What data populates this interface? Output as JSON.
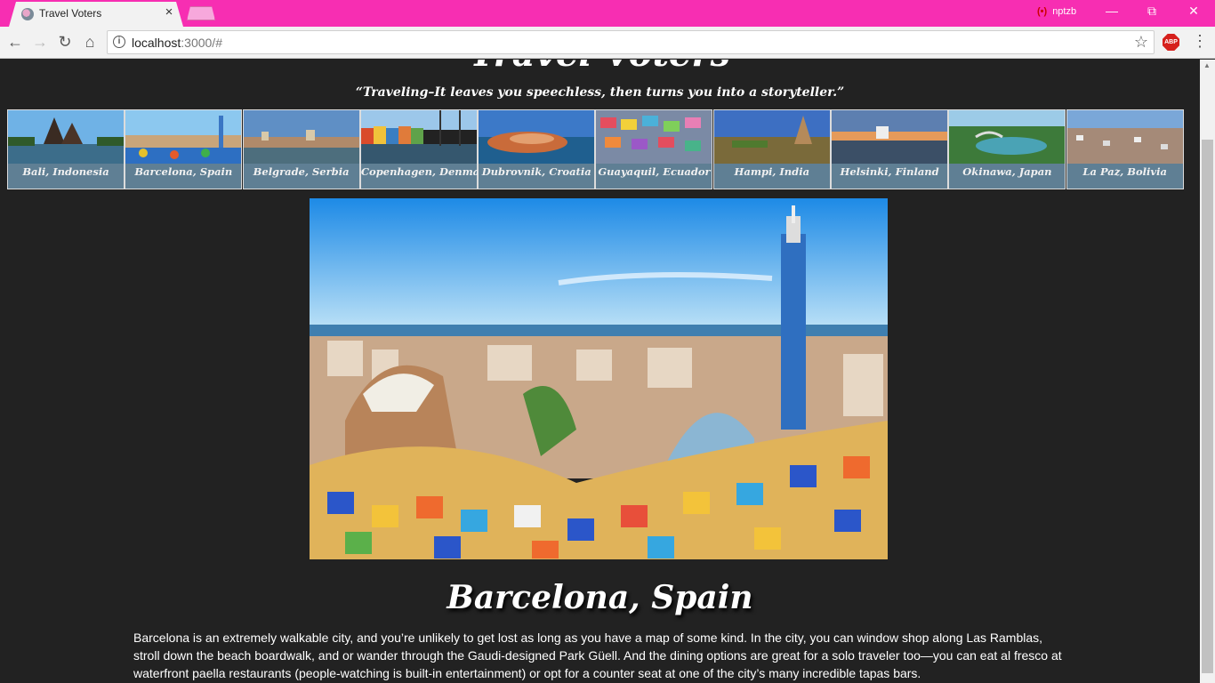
{
  "browser": {
    "tab_title": "Travel Voters",
    "tab_close": "×",
    "profile_name": "nptzb",
    "url_host": "localhost",
    "url_path": ":3000/#",
    "abp": "ABP",
    "theme_color": "#f72eb2"
  },
  "page": {
    "site_title": "Travel Voters",
    "quote": "“Traveling–It leaves you speechless, then turns you into a storyteller.”",
    "destinations": [
      {
        "label": "Bali, Indonesia"
      },
      {
        "label": "Barcelona, Spain"
      },
      {
        "label": "Belgrade, Serbia"
      },
      {
        "label": "Copenhagen, Denmark"
      },
      {
        "label": "Dubrovnik, Croatia"
      },
      {
        "label": "Guayaquil, Ecuador"
      },
      {
        "label": "Hampi, India"
      },
      {
        "label": "Helsinki, Finland"
      },
      {
        "label": "Okinawa, Japan"
      },
      {
        "label": "La Paz, Bolivia"
      }
    ],
    "selected": {
      "title": "Barcelona, Spain",
      "description": "Barcelona is an extremely walkable city, and you’re unlikely to get lost as long as you have a map of some kind. In the city, you can window shop along Las Ramblas, stroll down the beach boardwalk, and or wander through the Gaudi-designed Park Güell. And the dining options are great for a solo traveler too—you can eat al fresco at waterfront paella restaurants (people-watching is built-in entertainment) or opt for a counter seat at one of the city’s many incredible tapas bars."
    }
  }
}
